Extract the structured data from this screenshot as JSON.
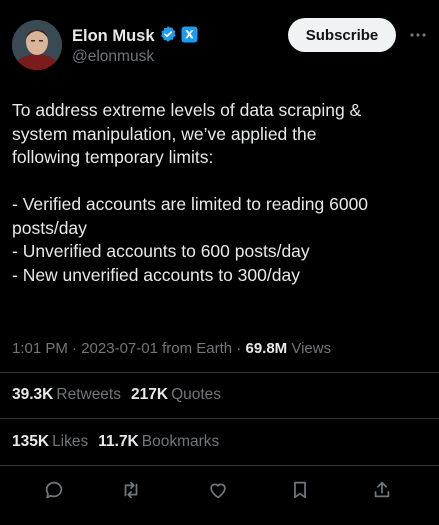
{
  "author": {
    "name": "Elon Musk",
    "handle": "@elonmusk",
    "verified_icon": "verified-badge-icon",
    "affiliation_icon": "x-affiliation-icon"
  },
  "header": {
    "subscribe_label": "Subscribe",
    "more_icon": "more-horizontal-icon"
  },
  "tweet": {
    "lines": [
      "To address extreme levels of data scraping &",
      "system manipulation, we’ve applied the",
      "following temporary limits:",
      "",
      "- Verified accounts are limited to reading 6000",
      "posts/day",
      "- Unverified accounts to 600 posts/day",
      "- New unverified accounts to 300/day"
    ]
  },
  "meta": {
    "time": "1:01 PM",
    "sep1": " · ",
    "date": "2023-07-01",
    "source": " from Earth",
    "sep2": " · ",
    "views_count": "69.8M",
    "views_label": " Views"
  },
  "stats": {
    "retweets_count": "39.3K",
    "retweets_label": "Retweets",
    "quotes_count": "217K",
    "quotes_label": "Quotes",
    "likes_count": "135K",
    "likes_label": "Likes",
    "bookmarks_count": "11.7K",
    "bookmarks_label": "Bookmarks"
  },
  "actions": [
    "reply-icon",
    "retweet-icon",
    "like-icon",
    "bookmark-icon",
    "share-icon"
  ],
  "colors": {
    "background": "#000000",
    "text": "#e7e9ea",
    "muted": "#71767b",
    "verified": "#1d9bf0",
    "divider": "#2f3336"
  }
}
